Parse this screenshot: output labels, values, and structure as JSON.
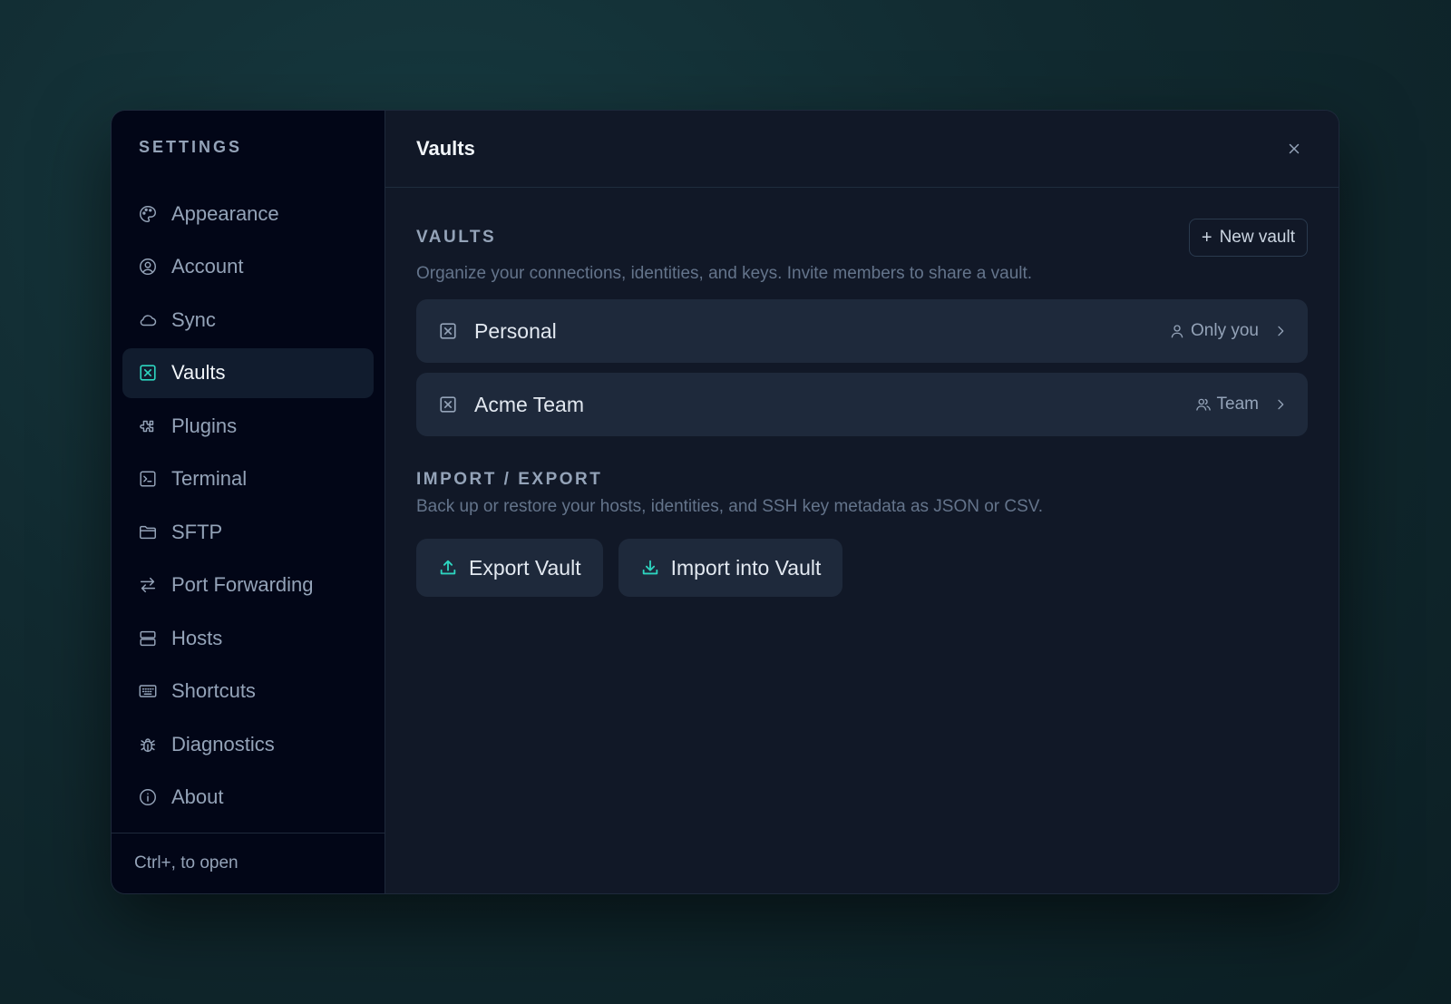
{
  "sidebar": {
    "title": "SETTINGS",
    "items": [
      {
        "label": "Appearance",
        "icon": "palette-icon"
      },
      {
        "label": "Account",
        "icon": "user-circle-icon"
      },
      {
        "label": "Sync",
        "icon": "cloud-icon"
      },
      {
        "label": "Vaults",
        "icon": "vault-icon",
        "active": true
      },
      {
        "label": "Plugins",
        "icon": "puzzle-icon"
      },
      {
        "label": "Terminal",
        "icon": "terminal-icon"
      },
      {
        "label": "SFTP",
        "icon": "folder-icon"
      },
      {
        "label": "Port Forwarding",
        "icon": "arrows-exchange-icon"
      },
      {
        "label": "Hosts",
        "icon": "server-icon"
      },
      {
        "label": "Shortcuts",
        "icon": "keyboard-icon"
      },
      {
        "label": "Diagnostics",
        "icon": "bug-icon"
      },
      {
        "label": "About",
        "icon": "info-icon"
      }
    ],
    "footer": "Ctrl+, to open"
  },
  "header": {
    "title": "Vaults"
  },
  "vaults_section": {
    "title": "VAULTS",
    "new_button": "New vault",
    "description": "Organize your connections, identities, and keys. Invite members to share a vault.",
    "vaults": [
      {
        "name": "Personal",
        "scope": "Only you",
        "scope_icon": "user-icon"
      },
      {
        "name": "Acme Team",
        "scope": "Team",
        "scope_icon": "users-icon"
      }
    ]
  },
  "import_export": {
    "title": "IMPORT / EXPORT",
    "description": "Back up or restore your hosts, identities, and SSH key metadata as JSON or CSV.",
    "export_label": "Export Vault",
    "import_label": "Import into Vault"
  },
  "colors": {
    "accent": "#2dd4bf",
    "sidebar_bg": "#020617",
    "panel_bg": "#111827",
    "row_bg": "#1e293b"
  }
}
